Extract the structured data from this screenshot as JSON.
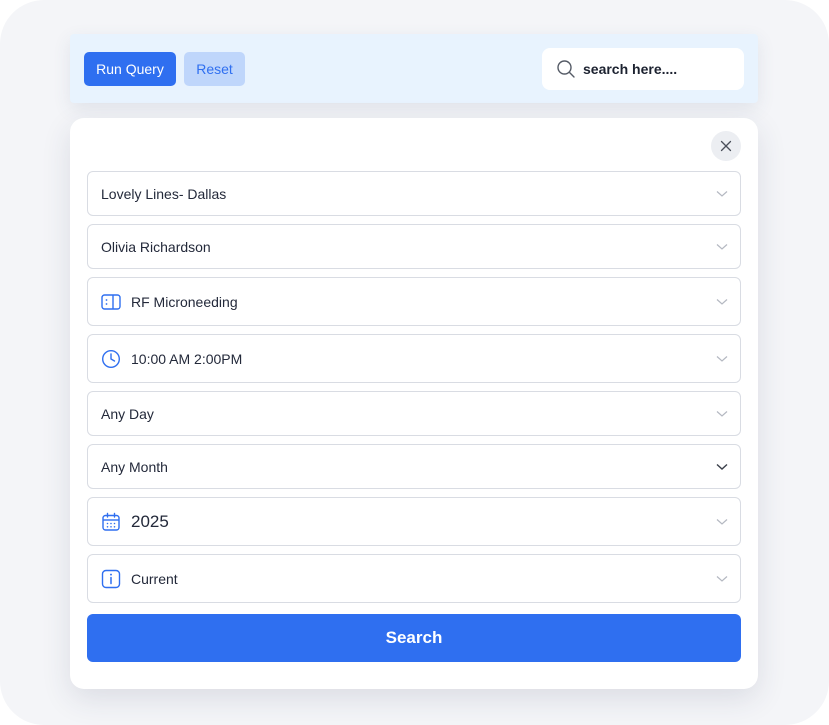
{
  "toolbar": {
    "run_query_label": "Run Query",
    "reset_label": "Reset",
    "search_placeholder": "search here...."
  },
  "panel": {
    "fields": [
      {
        "label": "Lovely Lines- Dallas",
        "icon": "none"
      },
      {
        "label": "Olivia Richardson",
        "icon": "none"
      },
      {
        "label": "RF Microneeding",
        "icon": "device-icon"
      },
      {
        "label": "10:00 AM 2:00PM",
        "icon": "clock-icon"
      },
      {
        "label": "Any Day",
        "icon": "none"
      },
      {
        "label": "Any Month",
        "icon": "none"
      },
      {
        "label": "2025",
        "icon": "calendar-icon"
      },
      {
        "label": "Current",
        "icon": "info-icon"
      }
    ],
    "search_button_label": "Search"
  },
  "colors": {
    "accent": "#2f6ff0",
    "accent_light": "#bfd6fb",
    "toolbar_bg": "#e8f3fe",
    "border": "#d9dce3"
  }
}
